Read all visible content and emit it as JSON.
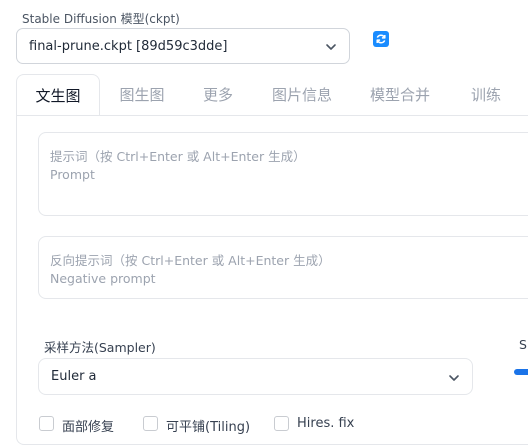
{
  "model": {
    "label": "Stable Diffusion 模型(ckpt)",
    "selected": "final-prune.ckpt [89d59c3dde]"
  },
  "tabs": [
    {
      "label": "文生图",
      "active": true
    },
    {
      "label": "图生图"
    },
    {
      "label": "更多"
    },
    {
      "label": "图片信息"
    },
    {
      "label": "模型合并"
    },
    {
      "label": "训练"
    }
  ],
  "prompt": {
    "label": "提示词（按 Ctrl+Enter 或 Alt+Enter 生成）",
    "placeholder": "Prompt"
  },
  "negative_prompt": {
    "label": "反向提示词（按 Ctrl+Enter 或 Alt+Enter 生成）",
    "placeholder": "Negative prompt"
  },
  "sampler": {
    "label": "采样方法(Sampler)",
    "selected": "Euler a"
  },
  "side_label": "S",
  "options": {
    "face_restore": "面部修复",
    "tiling": "可平铺(Tiling)",
    "hires_fix": "Hires. fix"
  },
  "colors": {
    "accent": "#1a8cff",
    "border": "#e5e7eb"
  }
}
